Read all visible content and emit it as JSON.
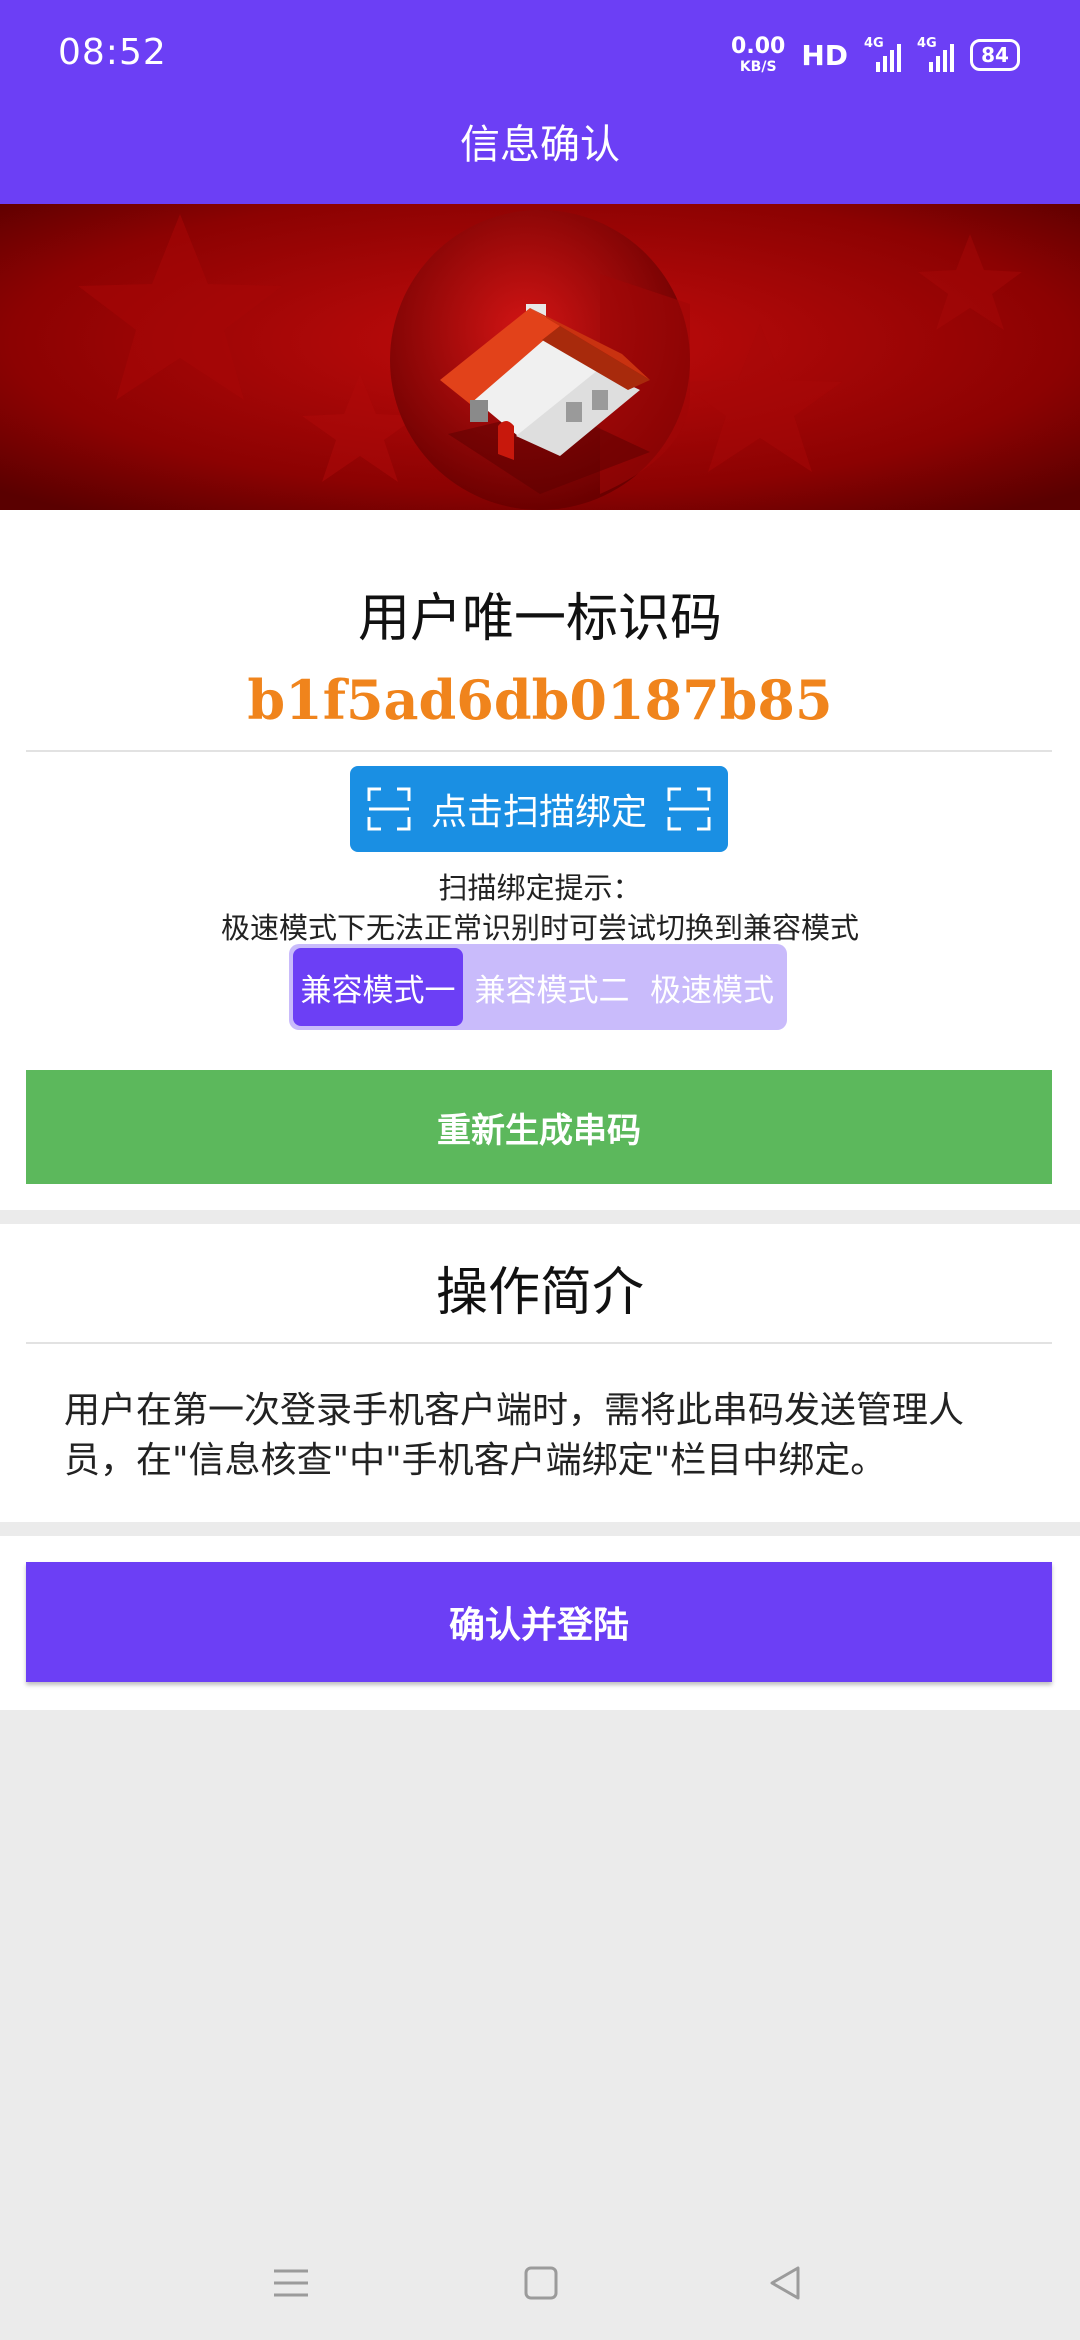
{
  "status_bar": {
    "time": "08:52",
    "net_speed_value": "0.00",
    "net_speed_unit": "KB/S",
    "hd_label": "HD",
    "signal1_label": "4G",
    "signal2_label": "4G",
    "battery": "84"
  },
  "app_bar": {
    "title": "信息确认"
  },
  "banner": {
    "image": "house-shield-icon"
  },
  "identity": {
    "label": "用户唯一标识码",
    "code": "b1f5ad6db0187b85"
  },
  "scan": {
    "button_label": "点击扫描绑定",
    "icon": "scan-icon",
    "hint_title": "扫描绑定提示：",
    "hint_body": "极速模式下无法正常识别时可尝试切换到兼容模式"
  },
  "modes": {
    "options": [
      "兼容模式一",
      "兼容模式二",
      "极速模式"
    ],
    "selected": "兼容模式一"
  },
  "regenerate_button": "重新生成串码",
  "intro": {
    "title": "操作简介",
    "body": "用户在第一次登录手机客户端时，需将此串码发送管理人员，在\"信息核查\"中\"手机客户端绑定\"栏目中绑定。"
  },
  "confirm_button": "确认并登陆",
  "nav": {
    "icons": [
      "menu-icon",
      "home-square-icon",
      "back-triangle-icon"
    ]
  },
  "colors": {
    "primary": "#6c3ff5",
    "code": "#f0841c",
    "scan_button": "#1a8fe3",
    "regenerate_button": "#5cb85c",
    "segment_bg": "#c9bbfb"
  }
}
